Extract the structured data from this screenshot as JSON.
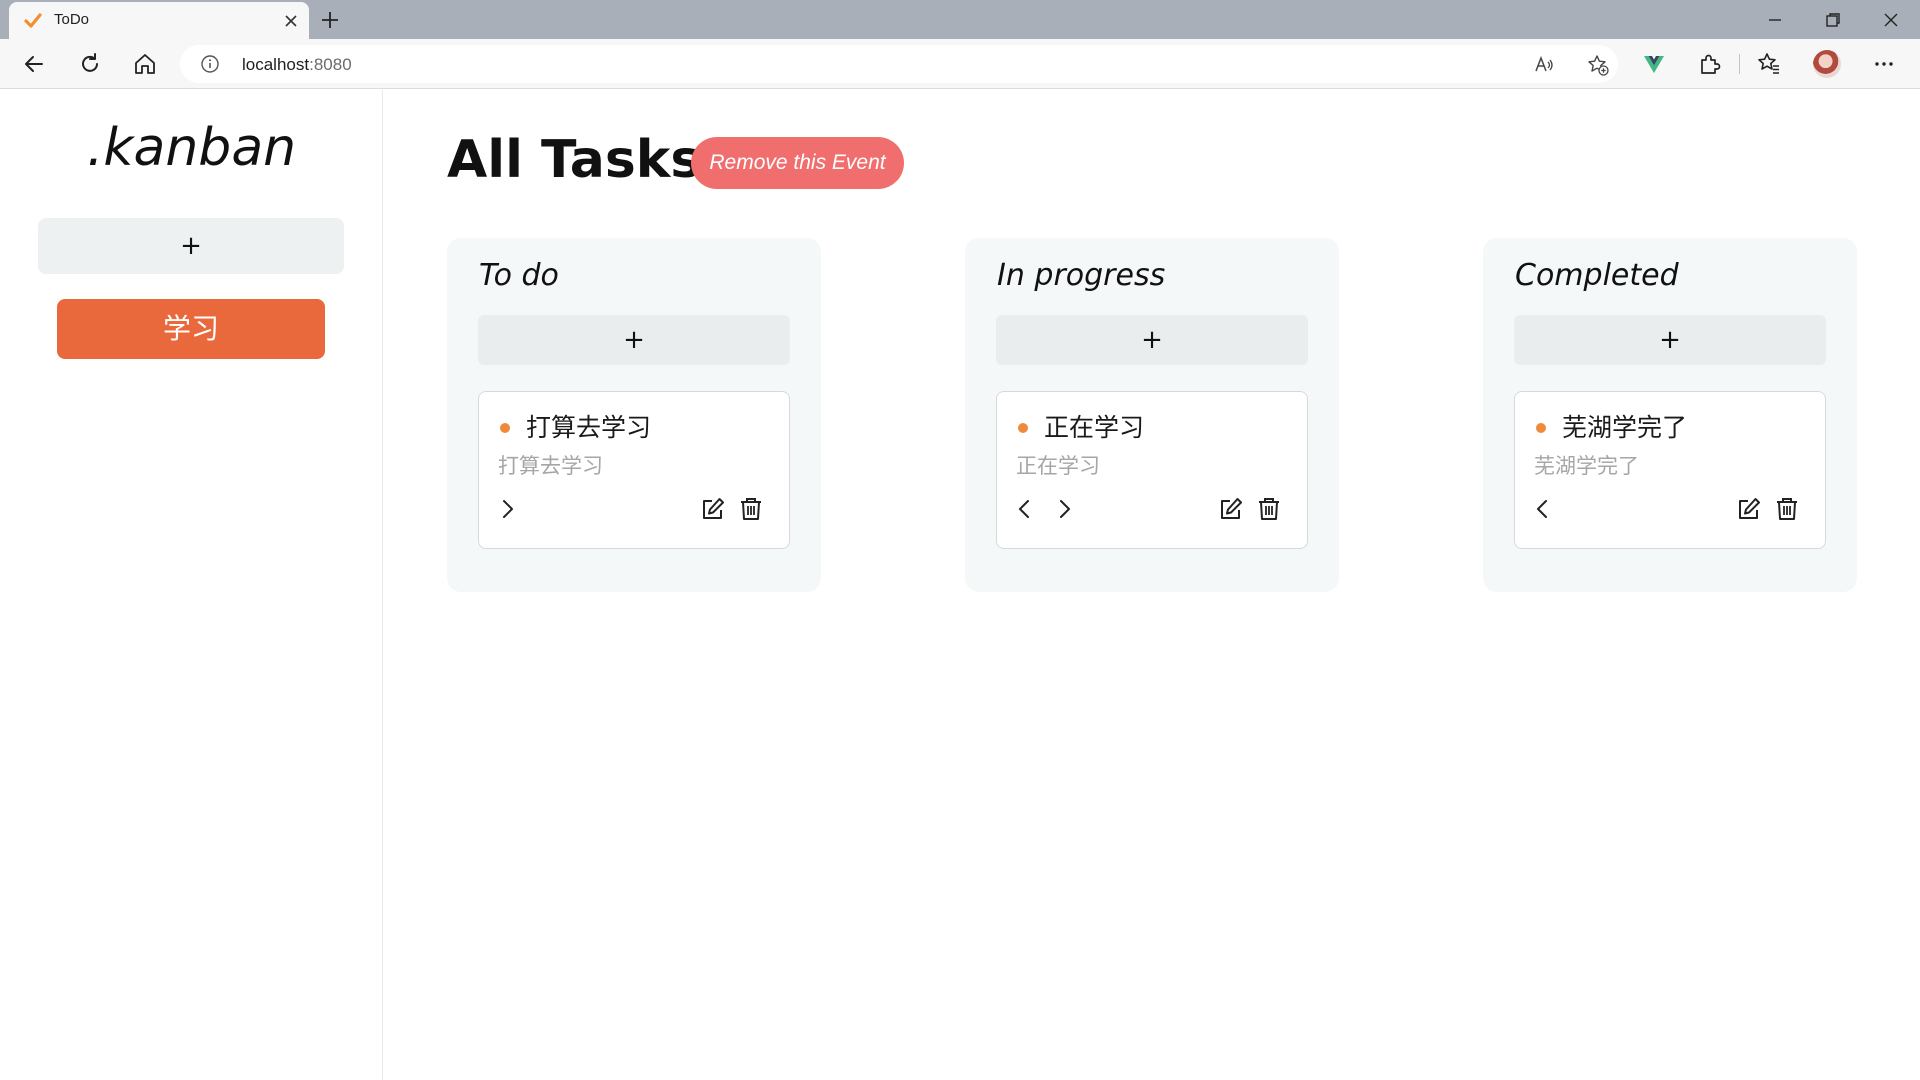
{
  "browser": {
    "tab_title": "ToDo",
    "url_host": "localhost",
    "url_port": ":8080"
  },
  "sidebar": {
    "brand": ".kanban",
    "add_label": "+",
    "boards": [
      {
        "label": "学习",
        "color": "#e9693c"
      }
    ]
  },
  "header": {
    "title": "All Tasks",
    "remove_label": "Remove this Event",
    "remove_color": "#f06e6e"
  },
  "columns": [
    {
      "title": "To do",
      "add_label": "+",
      "cards": [
        {
          "title": "打算去学习",
          "description": "打算去学习",
          "moves": [
            "right"
          ]
        }
      ]
    },
    {
      "title": "In progress",
      "add_label": "+",
      "cards": [
        {
          "title": "正在学习",
          "description": "正在学习",
          "moves": [
            "left",
            "right"
          ]
        }
      ]
    },
    {
      "title": "Completed",
      "add_label": "+",
      "cards": [
        {
          "title": "芜湖学完了",
          "description": "芜湖学完了",
          "moves": [
            "left"
          ]
        }
      ]
    }
  ],
  "icons": {
    "card_actions": [
      "edit-icon",
      "trash-icon"
    ],
    "dot_color": "#ee8a3c"
  }
}
